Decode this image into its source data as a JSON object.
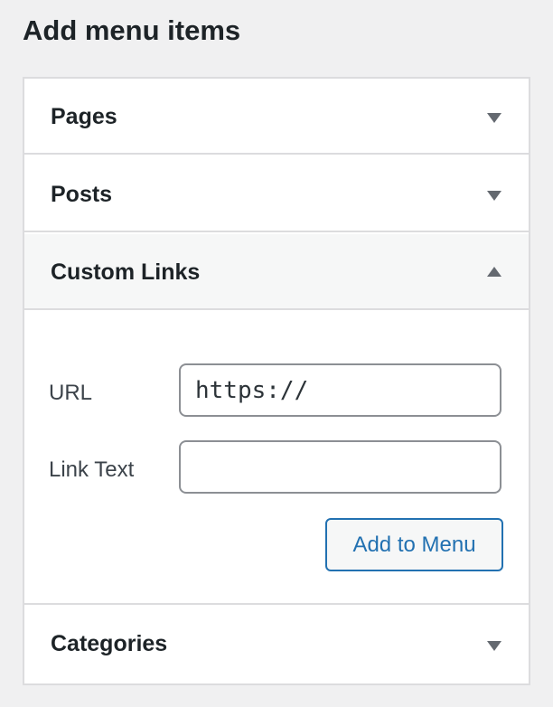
{
  "heading": "Add menu items",
  "sections": [
    {
      "title": "Pages",
      "state": "collapsed",
      "indicator": "triangle-down-icon"
    },
    {
      "title": "Posts",
      "state": "collapsed",
      "indicator": "triangle-down-icon"
    },
    {
      "title": "Custom Links",
      "state": "expanded",
      "indicator": "triangle-up-icon"
    },
    {
      "title": "Categories",
      "state": "collapsed",
      "indicator": "triangle-down-icon"
    }
  ],
  "custom_links": {
    "url_label": "URL",
    "url_value": "https://",
    "link_text_label": "Link Text",
    "link_text_value": "",
    "add_button_label": "Add to Menu"
  },
  "colors": {
    "accent": "#2271b1",
    "page_background": "#f0f0f1",
    "border": "#dcdcde",
    "expanded_header_background": "#f6f7f7"
  }
}
